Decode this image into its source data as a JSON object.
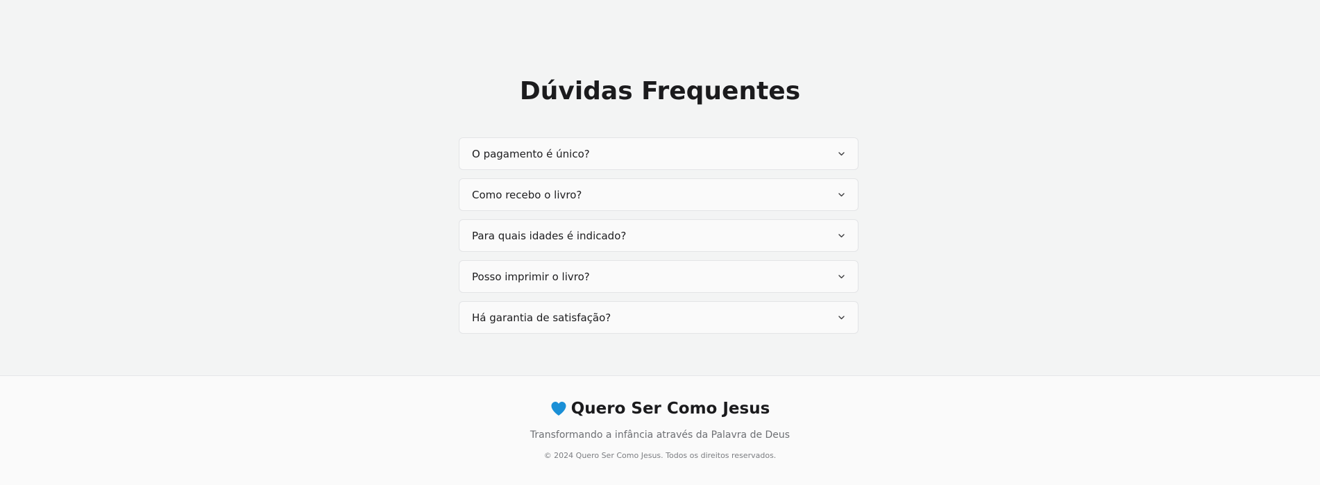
{
  "faq": {
    "title": "Dúvidas Frequentes",
    "items": [
      {
        "question": "O pagamento é único?"
      },
      {
        "question": "Como recebo o livro?"
      },
      {
        "question": "Para quais idades é indicado?"
      },
      {
        "question": "Posso imprimir o livro?"
      },
      {
        "question": "Há garantia de satisfação?"
      }
    ],
    "expand_icon": "chevron-down-icon"
  },
  "footer": {
    "brand_icon": "heart-icon",
    "brand_name": "Quero Ser Como Jesus",
    "tagline": "Transformando a infância através da Palavra de Deus",
    "copyright": "© 2024 Quero Ser Como Jesus. Todos os direitos reservados."
  },
  "colors": {
    "page_background": "#f3f4f4",
    "footer_background": "#fafafa",
    "heart": "#1a8fd6",
    "text": "#1c1c1e"
  }
}
